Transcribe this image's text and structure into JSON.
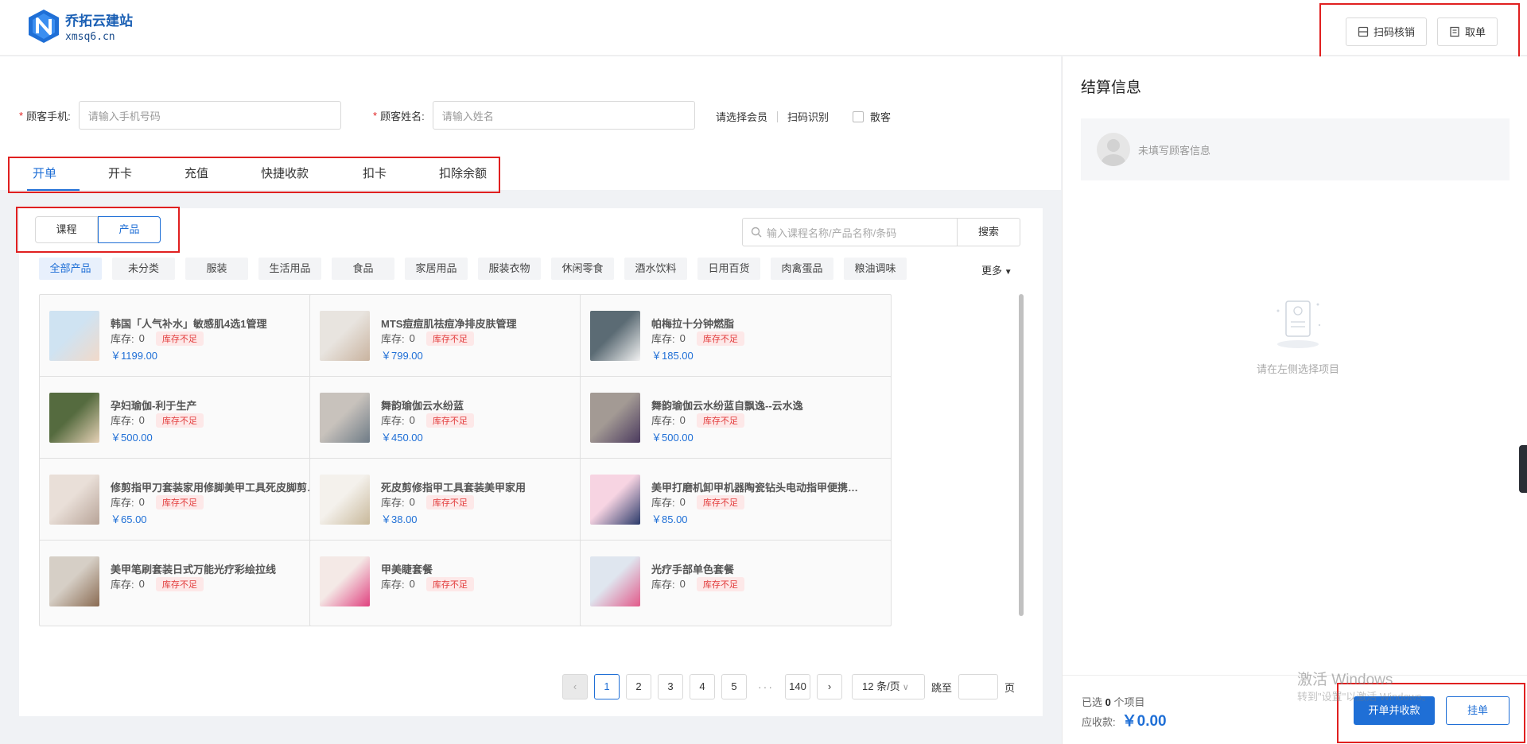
{
  "header": {
    "logo_name": "乔拓云建站",
    "logo_domain": "xmsq6.cn",
    "scan_btn": "扫码核销",
    "take_btn": "取单"
  },
  "form": {
    "phone_label": "顾客手机:",
    "phone_placeholder": "请输入手机号码",
    "name_label": "顾客姓名:",
    "name_placeholder": "请输入姓名",
    "select_member": "请选择会员",
    "scan_recognize": "扫码识别",
    "walk_in": "散客"
  },
  "tabs": [
    "开单",
    "开卡",
    "充值",
    "快捷收款",
    "扣卡",
    "扣除余额"
  ],
  "segment": {
    "course": "课程",
    "product": "产品"
  },
  "search": {
    "placeholder": "输入课程名称/产品名称/条码",
    "button": "搜索"
  },
  "categories": [
    "全部产品",
    "未分类",
    "服装",
    "生活用品",
    "食品",
    "家居用品",
    "服装衣物",
    "休闲零食",
    "酒水饮料",
    "日用百货",
    "肉禽蛋品",
    "粮油调味"
  ],
  "more": "更多",
  "products": [
    {
      "name": "韩国「人气补水」敏感肌4选1管理",
      "stock_label": "库存:",
      "stock": "0",
      "badge": "库存不足",
      "price": "￥1199.00"
    },
    {
      "name": "MTS痘痘肌祛痘净排皮肤管理",
      "stock_label": "库存:",
      "stock": "0",
      "badge": "库存不足",
      "price": "￥799.00"
    },
    {
      "name": "帕梅拉十分钟燃脂",
      "stock_label": "库存:",
      "stock": "0",
      "badge": "库存不足",
      "price": "￥185.00"
    },
    {
      "name": "孕妇瑜伽-利于生产",
      "stock_label": "库存:",
      "stock": "0",
      "badge": "库存不足",
      "price": "￥500.00"
    },
    {
      "name": "舞韵瑜伽云水纷蓝",
      "stock_label": "库存:",
      "stock": "0",
      "badge": "库存不足",
      "price": "￥450.00"
    },
    {
      "name": "舞韵瑜伽云水纷蓝自飘逸--云水逸",
      "stock_label": "库存:",
      "stock": "0",
      "badge": "库存不足",
      "price": "￥500.00"
    },
    {
      "name": "修剪指甲刀套装家用修脚美甲工具死皮脚剪…",
      "stock_label": "库存:",
      "stock": "0",
      "badge": "库存不足",
      "price": "￥65.00"
    },
    {
      "name": "死皮剪修指甲工具套装美甲家用",
      "stock_label": "库存:",
      "stock": "0",
      "badge": "库存不足",
      "price": "￥38.00"
    },
    {
      "name": "美甲打磨机卸甲机器陶瓷钻头电动指甲便携…",
      "stock_label": "库存:",
      "stock": "0",
      "badge": "库存不足",
      "price": "￥85.00"
    },
    {
      "name": "美甲笔刷套装日式万能光疗彩绘拉线",
      "stock_label": "库存:",
      "stock": "0",
      "badge": "库存不足",
      "price": ""
    },
    {
      "name": "甲美睫套餐",
      "stock_label": "库存:",
      "stock": "0",
      "badge": "库存不足",
      "price": ""
    },
    {
      "name": "光疗手部单色套餐",
      "stock_label": "库存:",
      "stock": "0",
      "badge": "库存不足",
      "price": ""
    }
  ],
  "pagination": {
    "pages": [
      "1",
      "2",
      "3",
      "4",
      "5"
    ],
    "dots": "···",
    "last": "140",
    "page_size": "12 条/页",
    "jump_label": "跳至",
    "jump_suffix": "页"
  },
  "checkout": {
    "title": "结算信息",
    "no_customer": "未填写顾客信息",
    "empty_hint": "请在左侧选择项目",
    "selected_prefix": "已选",
    "selected_count": "0",
    "selected_suffix": "个项目",
    "due_label": "应收款:",
    "due_amount": "￥0.00",
    "primary_btn": "开单并收款",
    "hold_btn": "挂单"
  },
  "watermark": {
    "line1": "激活 Windows",
    "line2": "转到\"设置\"以激活 Windows。"
  },
  "colors": {
    "accent": "#1f6fd6",
    "highlight_border": "#e02020",
    "badge_bg": "#fde8e8",
    "badge_text": "#e23b3b"
  }
}
